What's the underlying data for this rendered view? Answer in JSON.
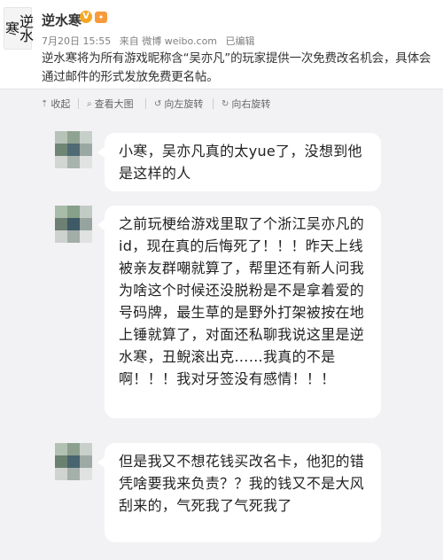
{
  "post": {
    "avatar_text": "逆水寒",
    "author": "逆水寒",
    "verified_icon": "verified-badge-icon",
    "level_icon": "user-level-icon",
    "time": "7月20日 15:55",
    "source": "来自 微博 weibo.com",
    "edited": "已编辑",
    "text": "逆水寒将为所有游戏昵称含“吴亦凡”的玩家提供一次免费改名机会，具体会通过邮件的形式发放免费更名帖。"
  },
  "toolbar": {
    "collapse": "收起",
    "view_large": "查看大图",
    "rotate_left": "向左旋转",
    "rotate_right": "向右旋转"
  },
  "chat": {
    "messages": [
      {
        "text": "小寒，吴亦凡真的太yue了，没想到他是这样的人"
      },
      {
        "text": "之前玩梗给游戏里取了个浙江吴亦凡的id，现在真的后悔死了！！！昨天上线被亲友群嘲就算了，帮里还有新人问我为啥这个时候还没脱粉是不是拿着爱的号码牌，最生草的是野外打架被按在地上锤就算了，对面还私聊我说这里是逆水寒，丑鲵滚出克……我真的不是啊！！！我对牙签没有感情！！！"
      },
      {
        "text": "但是我又不想花钱买改名卡，他犯的错凭啥要我来负责？？我的钱又不是大风刮来的，气死我了气死我了"
      }
    ]
  },
  "colors": {
    "chat_background": "#f2f2f5",
    "bubble": "#ffffff",
    "verified": "#f5a623"
  }
}
